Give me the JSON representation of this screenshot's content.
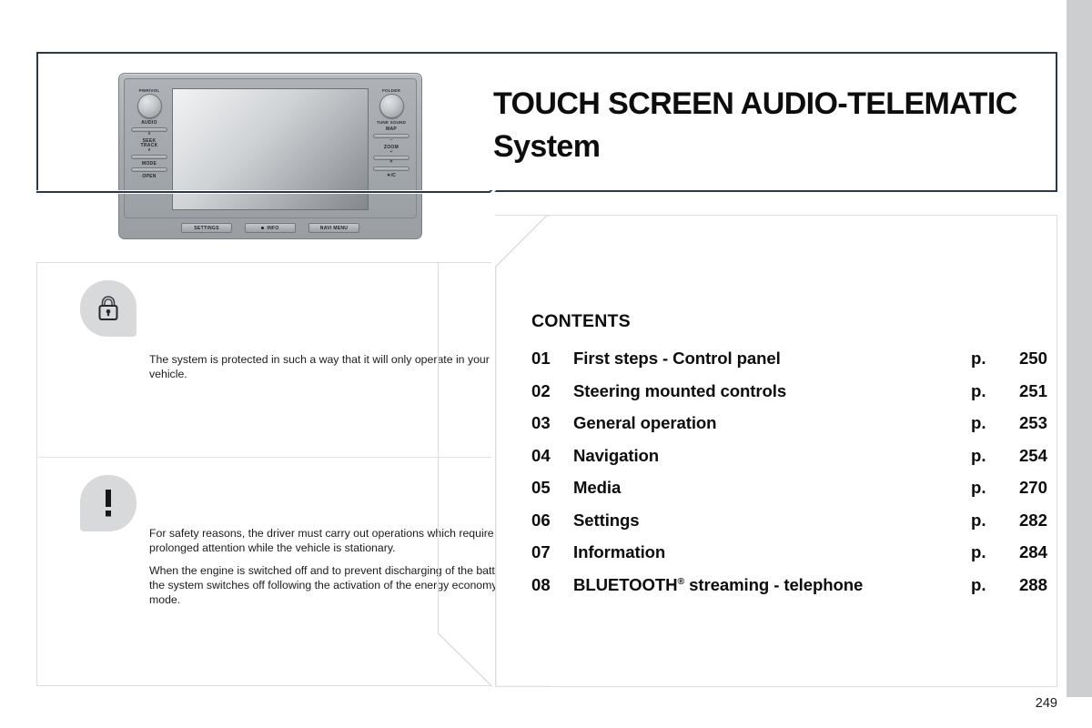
{
  "title": {
    "line1": "TOUCH SCREEN AUDIO-TELEMATIC",
    "line2": "System"
  },
  "device": {
    "left_column": {
      "knob_label": "PWR/VOL",
      "buttons": [
        {
          "label": "AUDIO"
        },
        {
          "label": "SEEK\nTRACK",
          "up": "∧",
          "down": "∨"
        },
        {
          "label": "MODE"
        },
        {
          "label": "OPEN"
        }
      ]
    },
    "right_column": {
      "knob_label_top": "FOLDER",
      "knob_label_bottom": "TUNE SOUND",
      "buttons": [
        {
          "label": "MAP"
        },
        {
          "label": "ZOOM",
          "minus": "−",
          "plus": "+"
        },
        {
          "label": "☀",
          "icon": "brightness-icon"
        },
        {
          "label": "✶/C"
        }
      ]
    },
    "bottom_buttons": [
      {
        "label": "SETTINGS",
        "has_dot": false
      },
      {
        "label": "INFO",
        "has_dot": true
      },
      {
        "label": "NAVI MENU",
        "has_dot": false
      }
    ]
  },
  "notes": [
    {
      "icon": "padlock-icon",
      "paragraphs": [
        "The system is protected in such a way that it will only operate in your vehicle."
      ]
    },
    {
      "icon": "warning-exclamation-icon",
      "paragraphs": [
        "For safety reasons, the driver must carry out operations which require prolonged attention while the vehicle is stationary.",
        "When the engine is switched off and to prevent discharging of the battery, the system switches off following the activation of the energy economy mode."
      ]
    }
  ],
  "contents": {
    "heading": "CONTENTS",
    "page_prefix": "p.",
    "entries": [
      {
        "num": "01",
        "title": "First steps - Control panel",
        "page": "250"
      },
      {
        "num": "02",
        "title": "Steering mounted controls",
        "page": "251"
      },
      {
        "num": "03",
        "title": "General operation",
        "page": "253"
      },
      {
        "num": "04",
        "title": "Navigation",
        "page": "254"
      },
      {
        "num": "05",
        "title": "Media",
        "page": "270"
      },
      {
        "num": "06",
        "title": "Settings",
        "page": "282"
      },
      {
        "num": "07",
        "title": "Information",
        "page": "284"
      },
      {
        "num": "08",
        "title": "BLUETOOTH",
        "title_sup": "®",
        "title_rest": " streaming - telephone",
        "page": "288"
      }
    ]
  },
  "folio": "249",
  "colors": {
    "panel_border_dark": "#2c3845",
    "panel_border_light": "#dcdddf",
    "badge_gray": "#d8d9db",
    "page_edge": "#cdced0"
  }
}
